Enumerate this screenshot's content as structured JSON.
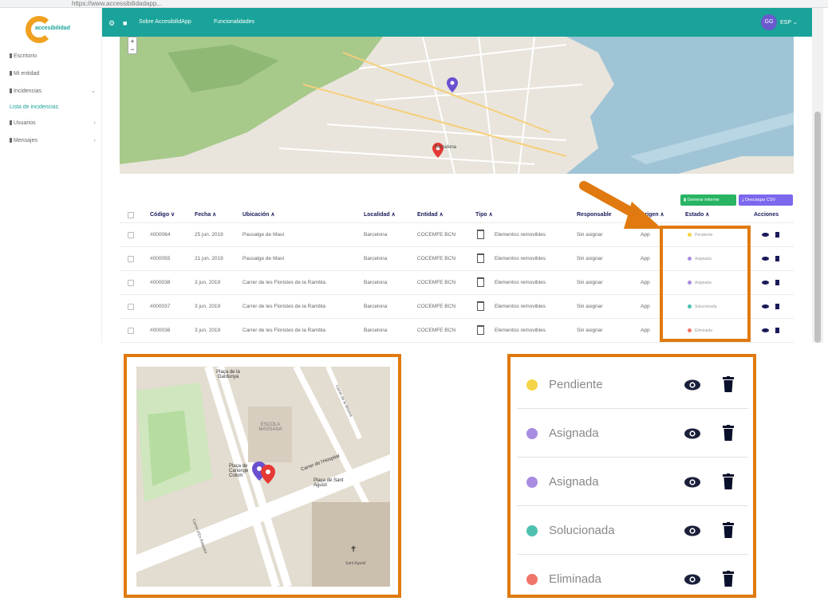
{
  "browser": {
    "url": "https://www.accessibilidadapp..."
  },
  "sidebar": {
    "logo_text": "accesibilidad",
    "items": [
      {
        "label": "Escritorio"
      },
      {
        "label": "Mi entidad"
      },
      {
        "label": "Incidencias"
      },
      {
        "label": "Lista de incidencias"
      },
      {
        "label": "Usuarios"
      },
      {
        "label": "Mensajes"
      }
    ]
  },
  "header": {
    "nav": [
      "Sobre AccesibilidApp",
      "Funcionalidades"
    ],
    "avatar": "GG",
    "lang": "ESP"
  },
  "buttons": {
    "report": "Generar informe",
    "csv": "Descargar CSV"
  },
  "table": {
    "headers": [
      "Código",
      "Fecha",
      "Ubicación",
      "Localidad",
      "Entidad",
      "Tipo",
      "Responsable",
      "Origen",
      "Estado",
      "Acciones"
    ],
    "rows": [
      {
        "code": "#000064",
        "date": "25 jun. 2019",
        "location": "Passatge de Maoi",
        "city": "Barcelona",
        "entity": "COCEMFE BCN",
        "type": "Elementos removibles",
        "responsible": "Sin asignar",
        "origin": "App",
        "state": "Pendiente"
      },
      {
        "code": "#000055",
        "date": "21 jun. 2019",
        "location": "Passatge de Maoi",
        "city": "Barcelona",
        "entity": "COCEMFE BCN",
        "type": "Elementos removibles",
        "responsible": "Sin asignar",
        "origin": "App",
        "state": "Asignada"
      },
      {
        "code": "#000038",
        "date": "3 jun. 2019",
        "location": "Carrer de les Floristes de la Rambla",
        "city": "Barcelona",
        "entity": "COCEMFE BCN",
        "type": "Elementos removibles",
        "responsible": "Sin asignar",
        "origin": "App",
        "state": "Asignada"
      },
      {
        "code": "#000037",
        "date": "3 jun. 2019",
        "location": "Carrer de les Floristes de la Rambla",
        "city": "Barcelona",
        "entity": "COCEMFE BCN",
        "type": "Elementos removibles",
        "responsible": "Sin asignar",
        "origin": "App",
        "state": "Solucionada"
      },
      {
        "code": "#000036",
        "date": "3 jun. 2019",
        "location": "Carrer de les Floristes de la Rambla",
        "city": "Barcelona",
        "entity": "COCEMFE BCN",
        "type": "Elementos removibles",
        "responsible": "Sin asignar",
        "origin": "App",
        "state": "Eliminada"
      }
    ]
  },
  "states": [
    {
      "label": "Pendiente",
      "color": "#f5d547"
    },
    {
      "label": "Asignada",
      "color": "#a98de0"
    },
    {
      "label": "Asignada",
      "color": "#a98de0"
    },
    {
      "label": "Solucionada",
      "color": "#4fc0b0"
    },
    {
      "label": "Eliminada",
      "color": "#f0766a"
    }
  ],
  "zoom_map": {
    "labels": [
      "Plaça de la Gardunya",
      "ESCOLA MASSANA",
      "Plaça de Canonge Colom",
      "Plaça de Sant Agustí",
      "Carrer de l'Hospital",
      "Carrer d'En Robador",
      "Carrer de la Morera",
      "Sant Agustí"
    ]
  },
  "map": {
    "labels": [
      "Barcelona"
    ]
  }
}
